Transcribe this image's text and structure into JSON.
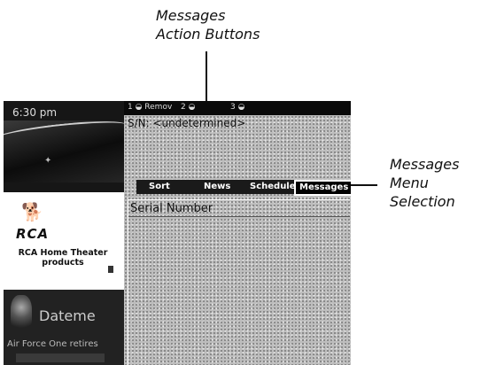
{
  "callouts": {
    "actions": [
      "Messages",
      "Action Buttons"
    ],
    "menu": [
      "Messages",
      "Menu",
      "Selection"
    ]
  },
  "sidebar": {
    "time": "6:30 pm",
    "ad": {
      "brand": "RCA",
      "line1": "RCA Home Theater",
      "line2": "products"
    },
    "news": {
      "title": "Dateme",
      "caption": "Air Force One retires"
    }
  },
  "action_buttons": [
    {
      "label": "1 ◒ Remov",
      "icon": "remote-button-icon"
    },
    {
      "label": "2 ◒",
      "icon": "remote-button-icon"
    },
    {
      "label": "3 ◒",
      "icon": "remote-button-icon"
    }
  ],
  "main": {
    "serial_header": "S/N: <undetermined>",
    "menu": [
      "Sort",
      "News",
      "Schedule",
      "Messages"
    ],
    "selected_menu": "Messages",
    "list_header": "Serial Number"
  }
}
